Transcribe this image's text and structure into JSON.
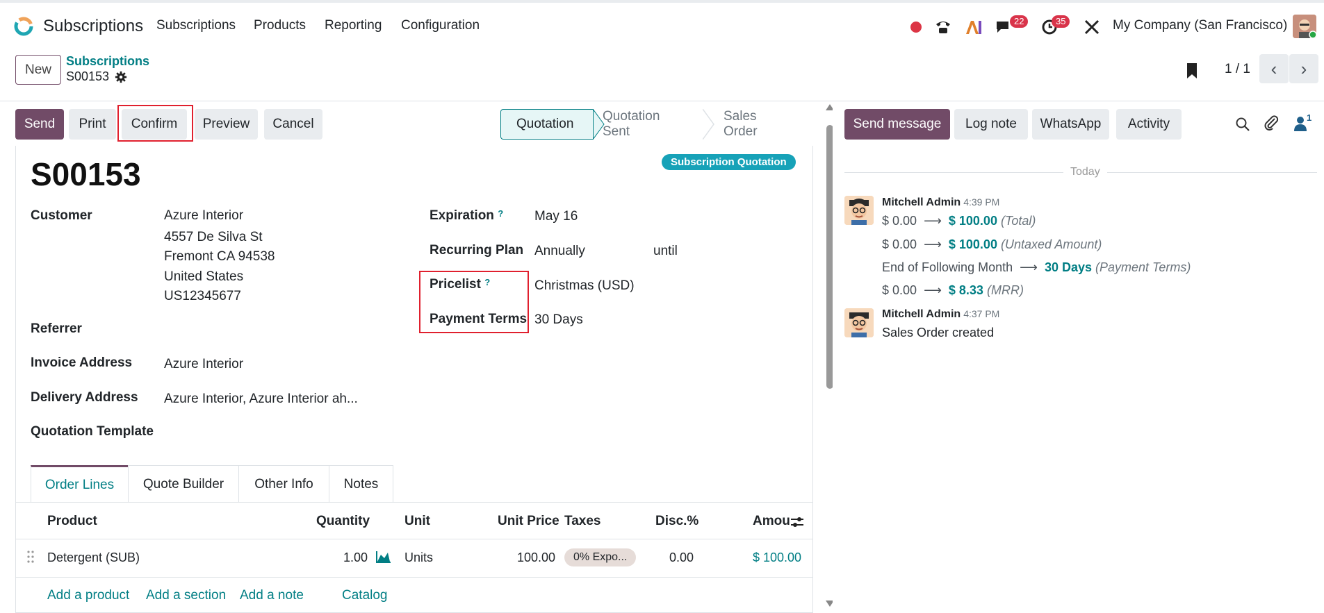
{
  "topbar": {
    "app_title": "Subscriptions",
    "menu": [
      "Subscriptions",
      "Products",
      "Reporting",
      "Configuration"
    ],
    "messages_badge": "22",
    "activities_badge": "35",
    "company": "My Company (San Francisco)"
  },
  "control_panel": {
    "new_label": "New",
    "breadcrumb_parent": "Subscriptions",
    "breadcrumb_current": "S00153",
    "pager": "1 / 1"
  },
  "actions": {
    "send": "Send",
    "print": "Print",
    "confirm": "Confirm",
    "preview": "Preview",
    "cancel": "Cancel"
  },
  "statusbar": [
    "Quotation",
    "Quotation Sent",
    "Sales Order"
  ],
  "statusbar_active": "Quotation",
  "form": {
    "name": "S00153",
    "ribbon": "Subscription Quotation",
    "customer_label": "Customer",
    "customer_lines": [
      "Azure Interior",
      "4557 De Silva St",
      "Fremont CA 94538",
      "United States",
      "US12345677"
    ],
    "referrer_label": "Referrer",
    "invoice_label": "Invoice Address",
    "invoice_value": "Azure Interior",
    "delivery_label": "Delivery Address",
    "delivery_value": "Azure Interior, Azure Interior ah...",
    "template_label": "Quotation Template",
    "expiration_label": "Expiration",
    "expiration_value": "May 16",
    "plan_label": "Recurring Plan",
    "plan_value": "Annually",
    "plan_until": "until",
    "pricelist_label": "Pricelist",
    "pricelist_value": "Christmas (USD)",
    "terms_label": "Payment Terms",
    "terms_value": "30 Days",
    "help_mark": "?"
  },
  "tabs": [
    "Order Lines",
    "Quote Builder",
    "Other Info",
    "Notes"
  ],
  "order_lines": {
    "headers": {
      "product": "Product",
      "quantity": "Quantity",
      "unit": "Unit",
      "unit_price": "Unit Price",
      "taxes": "Taxes",
      "disc": "Disc.%",
      "amount": "Amou"
    },
    "rows": [
      {
        "product": "Detergent (SUB)",
        "quantity": "1.00",
        "unit": "Units",
        "unit_price": "100.00",
        "taxes": "0% Expo...",
        "disc": "0.00",
        "amount": "$ 100.00"
      }
    ],
    "add_product": "Add a product",
    "add_section": "Add a section",
    "add_note": "Add a note",
    "catalog": "Catalog"
  },
  "chatter": {
    "send_message": "Send message",
    "log_note": "Log note",
    "whatsapp": "WhatsApp",
    "activity": "Activity",
    "followers_count": "1",
    "date_separator": "Today",
    "messages": [
      {
        "author": "Mitchell Admin",
        "time": "4:39 PM",
        "tracking": [
          {
            "old": "$ 0.00",
            "new": "$ 100.00",
            "field": "(Total)"
          },
          {
            "old": "$ 0.00",
            "new": "$ 100.00",
            "field": "(Untaxed Amount)"
          },
          {
            "old": "End of Following Month",
            "new": "30 Days",
            "field": "(Payment Terms)"
          },
          {
            "old": "$ 0.00",
            "new": "$ 8.33",
            "field": "(MRR)"
          }
        ]
      },
      {
        "author": "Mitchell Admin",
        "time": "4:37 PM",
        "body": "Sales Order created"
      }
    ]
  },
  "colors": {
    "brand": "#714b67",
    "link": "#017e84",
    "badge": "#d9344a",
    "highlight": "#e0202e"
  }
}
